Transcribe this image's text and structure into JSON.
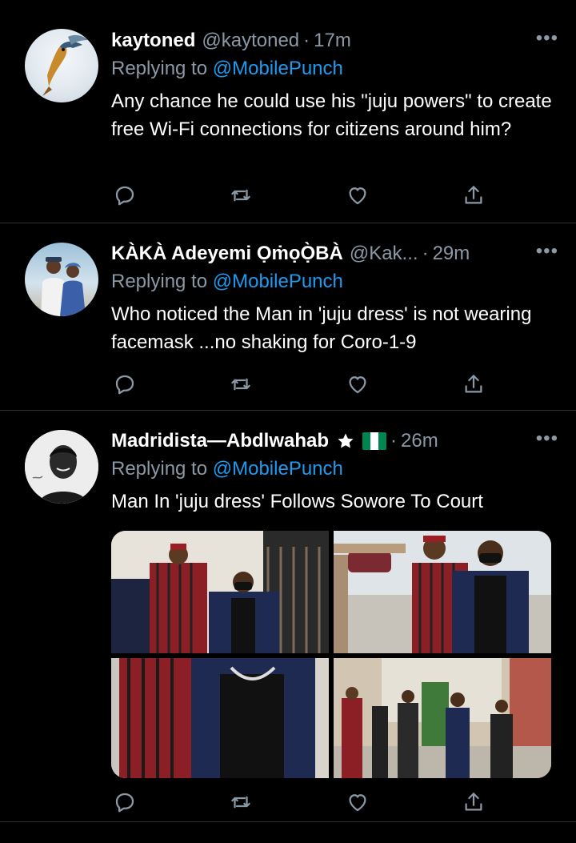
{
  "tweets": [
    {
      "name": "kaytoned",
      "handle": "@kaytoned",
      "time": "17m",
      "replying_prefix": "Replying to ",
      "replying_to": "@MobilePunch",
      "text": "Any chance he could use his \"juju powers\" to create free Wi-Fi connections for citizens around him?"
    },
    {
      "name": "KÀKÀ Adeyemi ỌṁọỌ̀BÀ",
      "handle": "@Kak...",
      "time": "29m",
      "replying_prefix": "Replying to ",
      "replying_to": "@MobilePunch",
      "text": "Who noticed the Man in 'juju dress' is not wearing facemask ...no shaking for Coro-1-9"
    },
    {
      "name": "Madridista—Abdlwahab",
      "time": "26m",
      "replying_prefix": "Replying to ",
      "replying_to": "@MobilePunch",
      "text": "Man In 'juju dress' Follows Sowore To Court"
    }
  ],
  "colors": {
    "accent": "#1d9bf0",
    "muted": "#8b98a5",
    "background": "#000000",
    "divider": "#2f3336"
  },
  "icons": [
    "more-icon",
    "reply-icon",
    "retweet-icon",
    "like-icon",
    "share-icon",
    "star-icon",
    "nigeria-flag-icon"
  ]
}
